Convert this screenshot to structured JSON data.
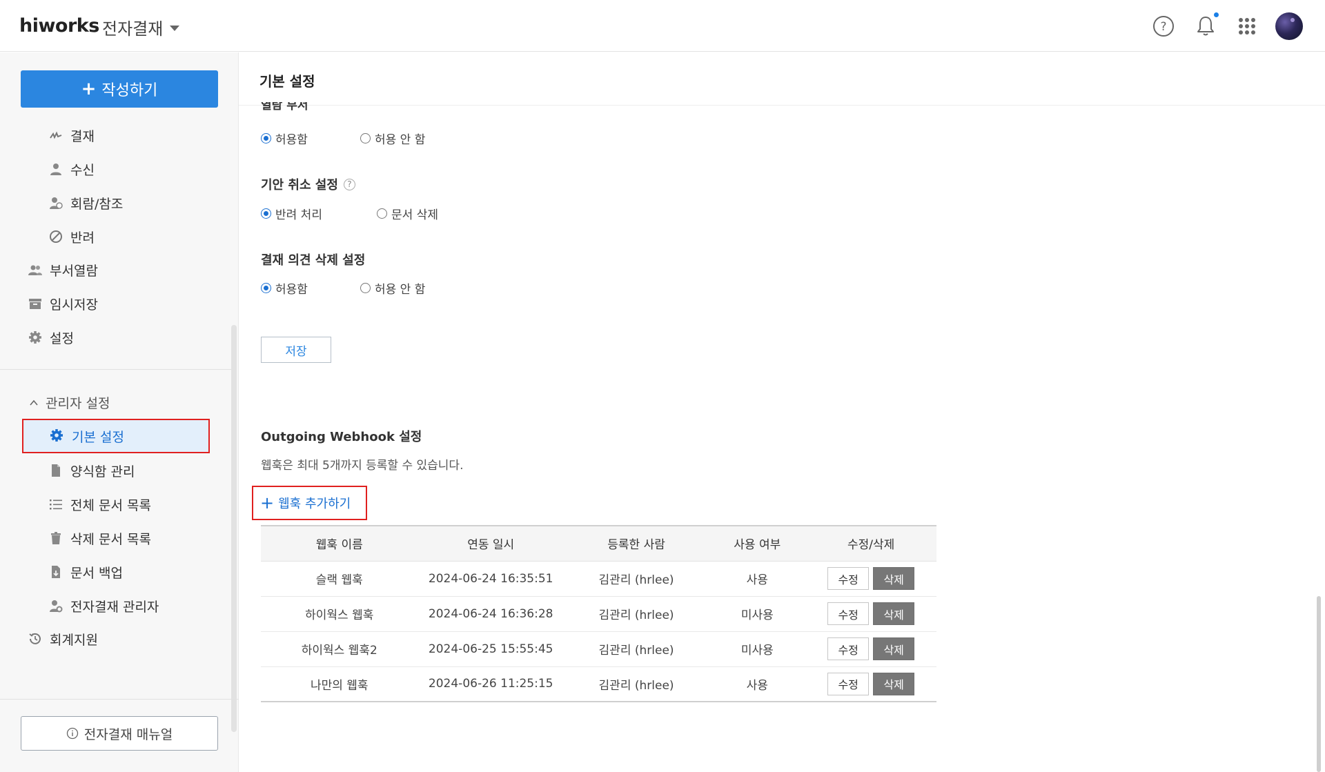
{
  "header": {
    "logo": "hiworks",
    "app_name": "전자결재"
  },
  "sidebar": {
    "write_button": "작성하기",
    "items": [
      {
        "label": "결재"
      },
      {
        "label": "수신"
      },
      {
        "label": "회람/참조"
      },
      {
        "label": "반려"
      },
      {
        "label": "부서열람"
      },
      {
        "label": "임시저장"
      },
      {
        "label": "설정"
      }
    ],
    "admin_section": "관리자 설정",
    "admin_items": [
      {
        "label": "기본 설정"
      },
      {
        "label": "양식함 관리"
      },
      {
        "label": "전체 문서 목록"
      },
      {
        "label": "삭제 문서 목록"
      },
      {
        "label": "문서 백업"
      },
      {
        "label": "전자결재 관리자"
      }
    ],
    "extra_item": "회계지원",
    "manual_button": "전자결재 매뉴얼"
  },
  "main": {
    "title": "기본 설정",
    "cut_label": "열람 부서",
    "settings": [
      {
        "label": "",
        "options": [
          "허용함",
          "허용 안 함"
        ],
        "selected": 0
      },
      {
        "label": "기안 취소 설정",
        "options": [
          "반려 처리",
          "문서 삭제"
        ],
        "selected": 0
      },
      {
        "label": "결재 의견 삭제 설정",
        "options": [
          "허용함",
          "허용 안 함"
        ],
        "selected": 0
      }
    ],
    "save_button": "저장",
    "webhook": {
      "title": "Outgoing Webhook 설정",
      "description": "웹훅은 최대 5개까지 등록할 수 있습니다.",
      "add_button": "웹훅 추가하기",
      "columns": [
        "웹훅 이름",
        "연동 일시",
        "등록한 사람",
        "사용 여부",
        "수정/삭제"
      ],
      "rows": [
        {
          "name": "슬랙 웹훅",
          "date": "2024-06-24 16:35:51",
          "user": "김관리 (hrlee)",
          "status": "사용"
        },
        {
          "name": "하이웍스 웹훅",
          "date": "2024-06-24 16:36:28",
          "user": "김관리 (hrlee)",
          "status": "미사용"
        },
        {
          "name": "하이웍스 웹훅2",
          "date": "2024-06-25 15:55:45",
          "user": "김관리 (hrlee)",
          "status": "미사용"
        },
        {
          "name": "나만의 웹훅",
          "date": "2024-06-26 11:25:15",
          "user": "김관리 (hrlee)",
          "status": "사용"
        }
      ],
      "edit_label": "수정",
      "delete_label": "삭제"
    }
  },
  "colors": {
    "primary": "#2b86e0",
    "highlight": "#e0201f",
    "active_bg": "#e3effb"
  }
}
